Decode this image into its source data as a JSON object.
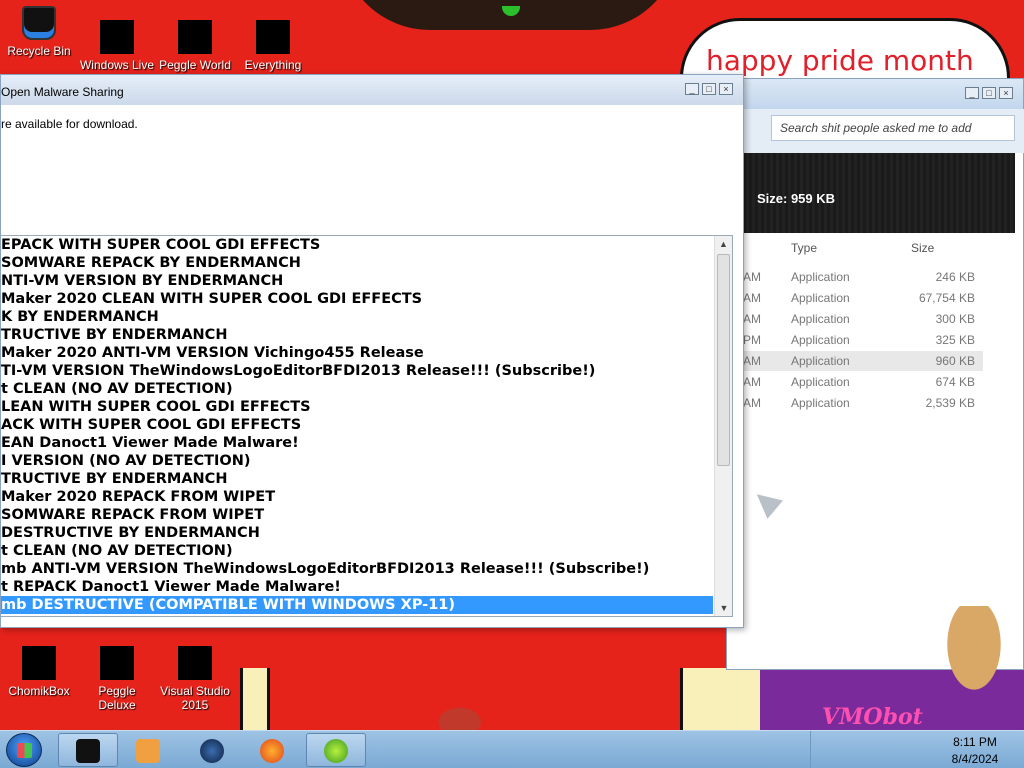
{
  "desktop": {
    "banner_text": "happy pride month",
    "top_icons": [
      {
        "label": "Recycle Bin"
      },
      {
        "label": "Windows Live"
      },
      {
        "label": "Peggle World"
      },
      {
        "label": "Everything"
      }
    ],
    "bottom_icons": [
      {
        "label": "ChomikBox"
      },
      {
        "label": "Peggle Deluxe"
      },
      {
        "label": "Visual Studio 2015"
      }
    ],
    "wallpaper_logo": "VMObot"
  },
  "dialog": {
    "title": "Open Malware Sharing",
    "message": "re available for download.",
    "items": [
      "EPACK WITH SUPER COOL GDI EFFECTS",
      "SOMWARE REPACK BY ENDERMANCH",
      "NTI-VM VERSION BY ENDERMANCH",
      "Maker 2020 CLEAN WITH SUPER COOL GDI EFFECTS",
      "K BY ENDERMANCH",
      "TRUCTIVE BY ENDERMANCH",
      "Maker 2020 ANTI-VM VERSION Vichingo455 Release",
      "TI-VM VERSION TheWindowsLogoEditorBFDI2013 Release!!! (Subscribe!)",
      "t CLEAN (NO AV DETECTION)",
      "LEAN WITH SUPER COOL GDI EFFECTS",
      "ACK WITH SUPER COOL GDI EFFECTS",
      "EAN Danoct1 Viewer Made Malware!",
      "I VERSION (NO AV DETECTION)",
      "TRUCTIVE BY ENDERMANCH",
      "Maker 2020 REPACK FROM WIPET",
      "SOMWARE REPACK FROM WIPET",
      "DESTRUCTIVE BY ENDERMANCH",
      "t CLEAN (NO AV DETECTION)",
      "mb ANTI-VM VERSION TheWindowsLogoEditorBFDI2013 Release!!! (Subscribe!)",
      "t REPACK Danoct1 Viewer Made Malware!",
      "mb DESTRUCTIVE (COMPATIBLE WITH WINDOWS XP-11)"
    ],
    "selected_index": 20
  },
  "explorer": {
    "search_placeholder": "Search shit people asked me to add",
    "size_label": "Size: 959 KB",
    "columns": {
      "type": "Type",
      "size": "Size"
    },
    "rows": [
      {
        "time": "AM",
        "type": "Application",
        "size": "246 KB"
      },
      {
        "time": "AM",
        "type": "Application",
        "size": "67,754 KB"
      },
      {
        "time": "AM",
        "type": "Application",
        "size": "300 KB"
      },
      {
        "time": "PM",
        "type": "Application",
        "size": "325 KB"
      },
      {
        "time": "AM",
        "type": "Application",
        "size": "960 KB"
      },
      {
        "time": "AM",
        "type": "Application",
        "size": "674 KB"
      },
      {
        "time": "AM",
        "type": "Application",
        "size": "2,539 KB"
      }
    ],
    "selected_row": 4
  },
  "taskbar": {
    "time": "8:11 PM",
    "date": "8/4/2024"
  }
}
